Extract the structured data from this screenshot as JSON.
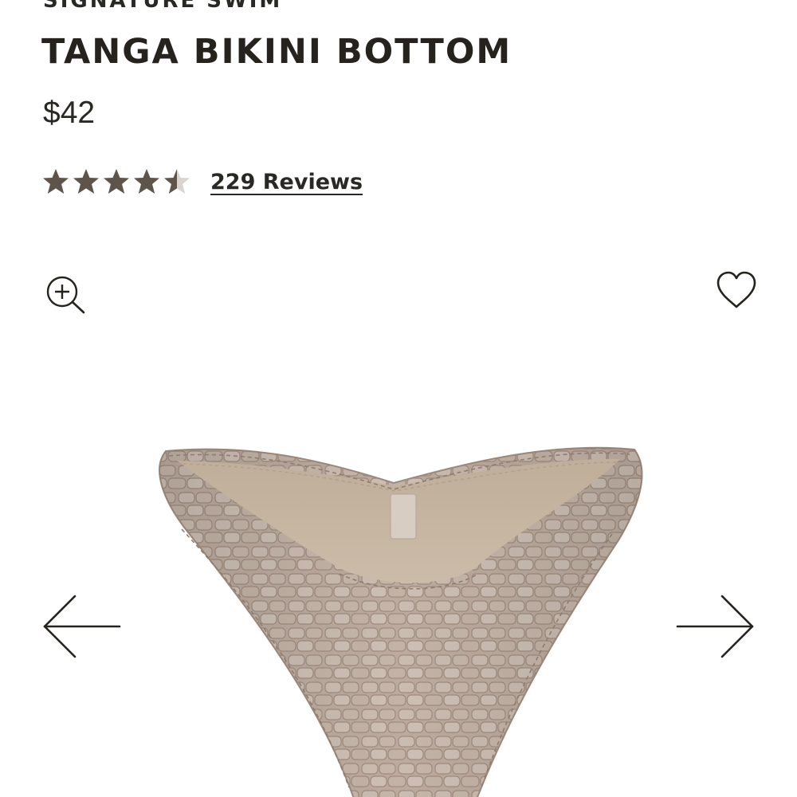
{
  "product": {
    "collection": "SIGNATURE SWIM",
    "title": "TANGA BIKINI BOTTOM",
    "price": "$42",
    "rating": 4.5,
    "rating_max": 5,
    "reviews_label": "229 Reviews",
    "image_alt": "Tanga bikini bottom in croc texture"
  },
  "colors": {
    "text": "#26231f",
    "star": "#5e544a",
    "star_empty": "#d9d4ce",
    "fabric": "#bcaa9e",
    "fabric_dark": "#a39081",
    "lining": "#c8b8a4"
  },
  "icons": {
    "zoom": "zoom-in-icon",
    "wishlist": "heart-outline-icon",
    "prev": "arrow-left-icon",
    "next": "arrow-right-icon"
  }
}
